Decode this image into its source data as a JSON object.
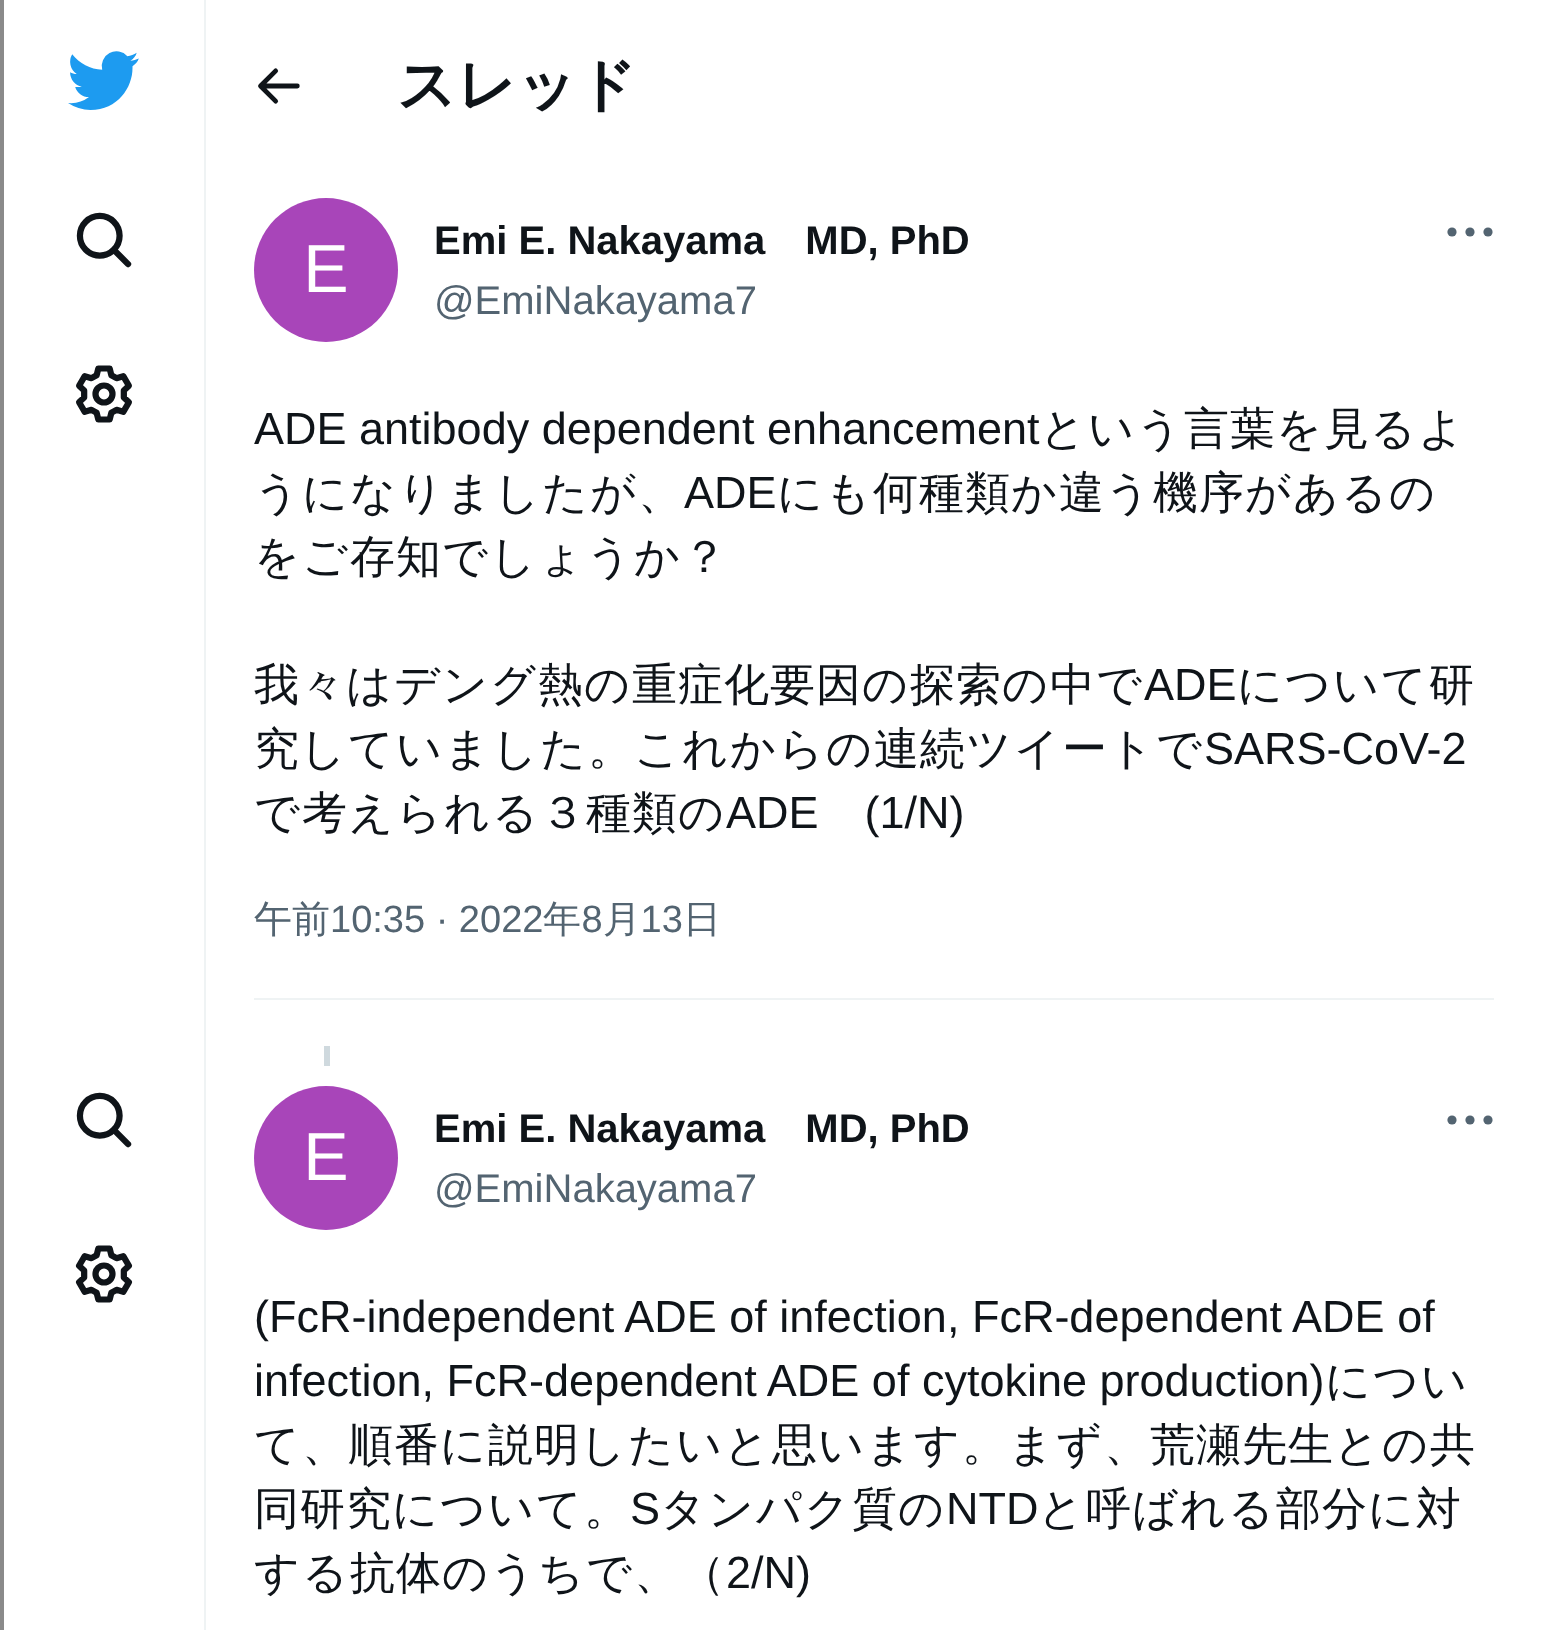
{
  "header": {
    "title": "スレッド"
  },
  "tweets": [
    {
      "avatar_letter": "E",
      "name": "Emi E. Nakayama　MD, PhD",
      "handle": "@EmiNakayama7",
      "connected_above": false,
      "paragraphs": [
        "ADE antibody dependent enhancementという言葉を見るようになりましたが、ADEにも何種類か違う機序があるのをご存知でしょうか？",
        "我々はデング熱の重症化要因の探索の中でADEについて研究していました。これからの連続ツイートでSARS-CoV-2で考えられる３種類のADE　(1/N)"
      ],
      "timestamp": "午前10:35 · 2022年8月13日"
    },
    {
      "avatar_letter": "E",
      "name": "Emi E. Nakayama　MD, PhD",
      "handle": "@EmiNakayama7",
      "connected_above": true,
      "paragraphs": [
        "(FcR-independent ADE of infection, FcR-dependent ADE of  infection, FcR-dependent ADE of cytokine production)について、順番に説明したいと思います。まず、荒瀬先生との共同研究について。Sタンパク質のNTDと呼ばれる部分に対する抗体のうちで、（2/N)"
      ]
    }
  ]
}
